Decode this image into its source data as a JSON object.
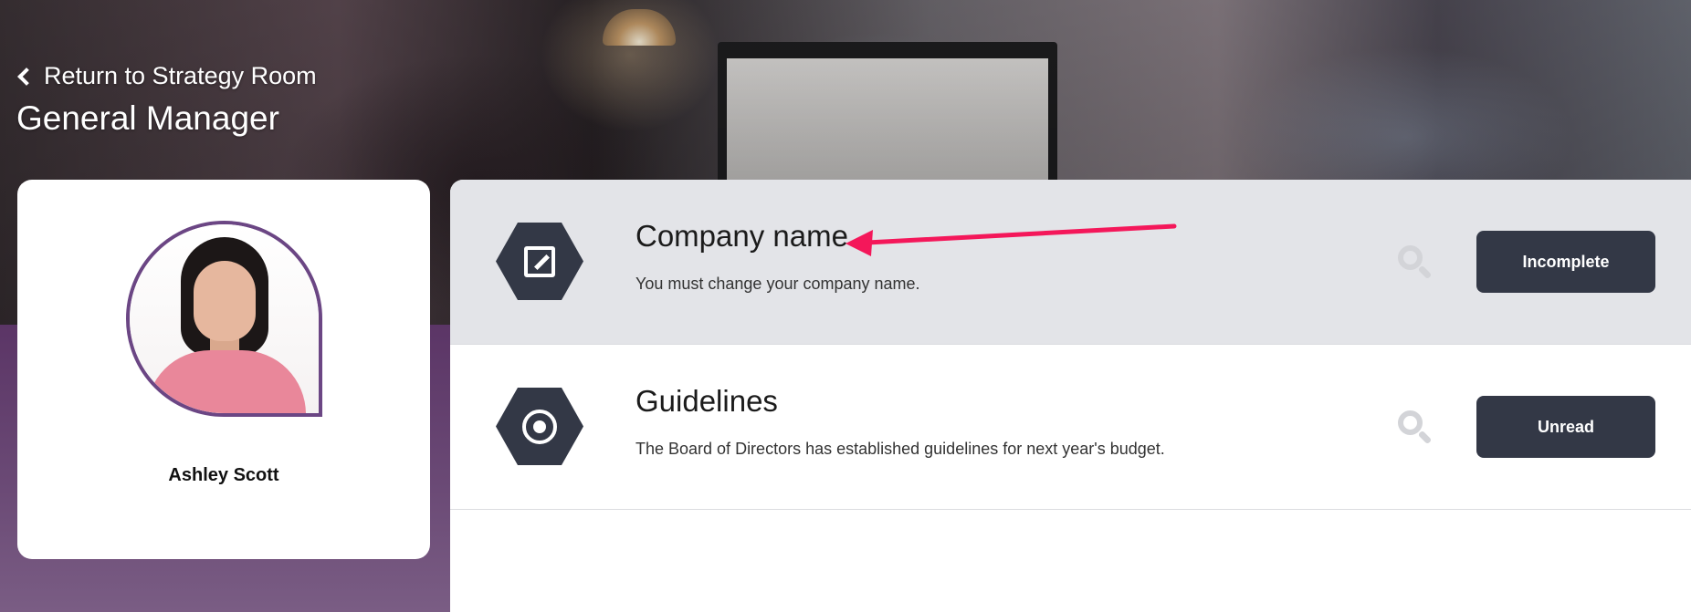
{
  "header": {
    "back_link_label": "Return to Strategy Room",
    "page_title": "General Manager"
  },
  "profile": {
    "name": "Ashley Scott"
  },
  "tasks": [
    {
      "title": "Company name",
      "description": "You must change your company name.",
      "icon": "edit-icon",
      "status": "Incomplete"
    },
    {
      "title": "Guidelines",
      "description": "The Board of Directors has established guidelines for next year's budget.",
      "icon": "target-icon",
      "status": "Unread"
    }
  ],
  "colors": {
    "accent_dark": "#333846",
    "avatar_border": "#6b4684",
    "annotation_arrow": "#f4175a",
    "active_row_bg": "#e3e4e8"
  }
}
